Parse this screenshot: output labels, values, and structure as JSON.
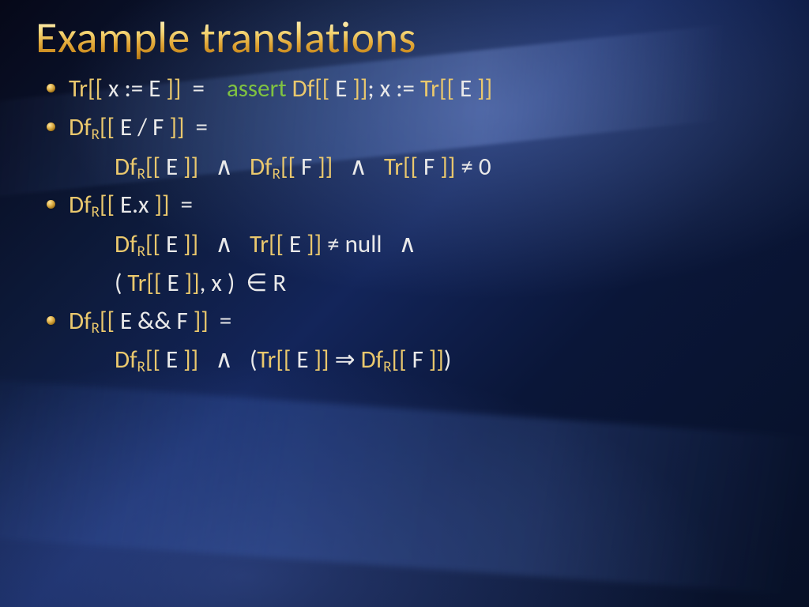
{
  "title": "Example translations",
  "colors": {
    "gold": "#eac86d",
    "green": "#7fc241",
    "body": "#e9e9e9"
  },
  "tokens": {
    "Tr": "Tr",
    "Df": "Df",
    "sub_R": "R",
    "open": "[[",
    "close": "]]",
    "assign": ":=",
    "eq": "=",
    "neq": "≠",
    "and": "∧",
    "implies": "⇒",
    "in": "∈",
    "assert": "assert",
    "x": "x",
    "E": "E",
    "F": "F",
    "div": "/",
    "dot": ".",
    "andand": "&&",
    "zero": "0",
    "null": "null",
    "R": "R",
    "semi": ";",
    "comma": ",",
    "lp": "(",
    "rp": ")"
  }
}
